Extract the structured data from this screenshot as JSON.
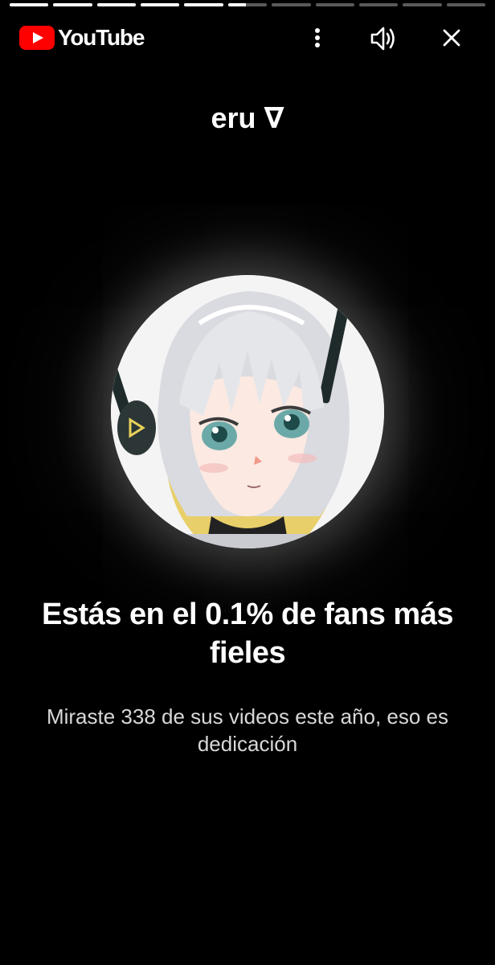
{
  "brand": {
    "logo_text": "YouTube",
    "accent": "#FF0000"
  },
  "progress": {
    "total_segments": 11,
    "completed_segments": 5,
    "current_segment_fill": 0.45
  },
  "toolbar": {
    "more_icon": "more-vertical-icon",
    "sound_icon": "volume-icon",
    "close_icon": "close-icon"
  },
  "channel": {
    "name": "eru ∇"
  },
  "story": {
    "headline": "Estás en el 0.1% de fans más fieles",
    "subtext": "Miraste 338 de sus videos este año, eso es dedicación"
  }
}
